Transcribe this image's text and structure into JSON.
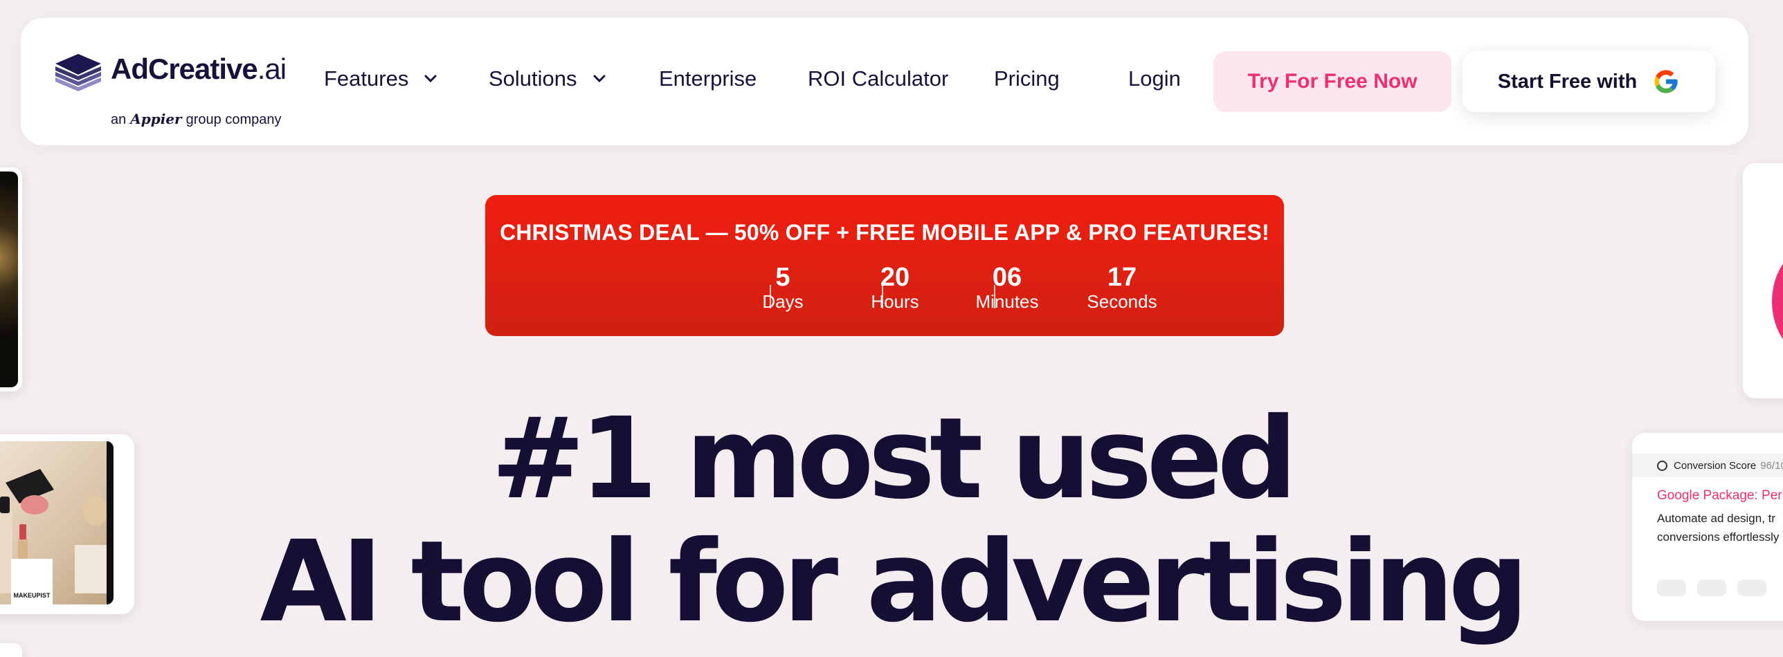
{
  "brand": {
    "name": "AdCreative",
    "suffix": ".ai",
    "tagline_prefix": "an",
    "tagline_brand": "Appier",
    "tagline_suffix": "group company"
  },
  "nav": {
    "features": "Features",
    "solutions": "Solutions",
    "enterprise": "Enterprise",
    "roi_calculator": "ROI Calculator",
    "pricing": "Pricing",
    "login": "Login",
    "try_free": "Try For Free Now",
    "start_free_google": "Start Free with"
  },
  "promo": {
    "title": "CHRISTMAS DEAL — 50% OFF + FREE MOBILE APP & PRO FEATURES!",
    "countdown": [
      {
        "value": "5",
        "label": "Days"
      },
      {
        "value": "20",
        "label": "Hours"
      },
      {
        "value": "06",
        "label": "Minutes"
      },
      {
        "value": "17",
        "label": "Seconds"
      }
    ]
  },
  "hero": {
    "line1": "#1 most used",
    "line2": "AI tool for advertising"
  },
  "side_cards": {
    "makeup_label": "MAKEUPIST",
    "conversion_label": "Conversion Score",
    "conversion_score": "96/10",
    "ad_title": "Google Package: Per",
    "ad_desc_1": "Automate ad design, tr",
    "ad_desc_2": "conversions effortlessly"
  },
  "colors": {
    "accent_pink": "#ee2f73",
    "promo_red": "#e8200f",
    "text_dark": "#140f33",
    "background": "#f4eef1"
  }
}
